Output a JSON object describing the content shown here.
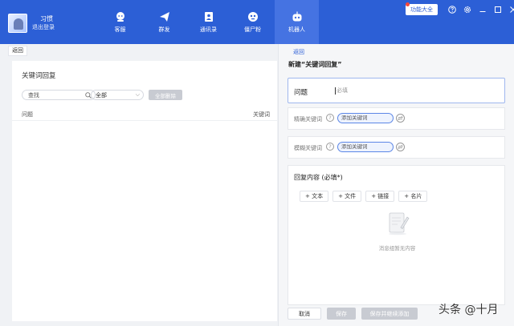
{
  "user": {
    "name": "习惯",
    "logout": "退出登录"
  },
  "nav": [
    {
      "label": "客服",
      "icon": "customer-service-icon"
    },
    {
      "label": "群发",
      "icon": "send-plane-icon"
    },
    {
      "label": "通讯录",
      "icon": "contacts-icon"
    },
    {
      "label": "僵尸粉",
      "icon": "zombie-icon"
    },
    {
      "label": "机器人",
      "icon": "robot-icon",
      "active": true
    }
  ],
  "topbar": {
    "feature_button": "功能大全",
    "accent": "#2c5fd6"
  },
  "back_tab": "返回",
  "left": {
    "title": "关键词回复",
    "search_placeholder": "查找",
    "filter_selected": "全部",
    "delete_all": "全部删除",
    "columns": [
      "问题",
      "关键词"
    ]
  },
  "right": {
    "back": "返回",
    "title": "新建“关键词回复”",
    "question_label": "问题",
    "question_placeholder": "必填",
    "exact_label": "精确关键词",
    "fuzzy_label": "模糊关键词",
    "add_keyword": "添加关键词",
    "reply_title": "回复内容 (必填*)",
    "reply_buttons": [
      "+ 文本",
      "+ 文件",
      "+ 链接",
      "+ 名片"
    ],
    "empty_text": "消息组暂无内容",
    "cancel": "取消",
    "save": "保存",
    "save_continue": "保存并继续添加"
  },
  "watermark": "头条 @十月"
}
